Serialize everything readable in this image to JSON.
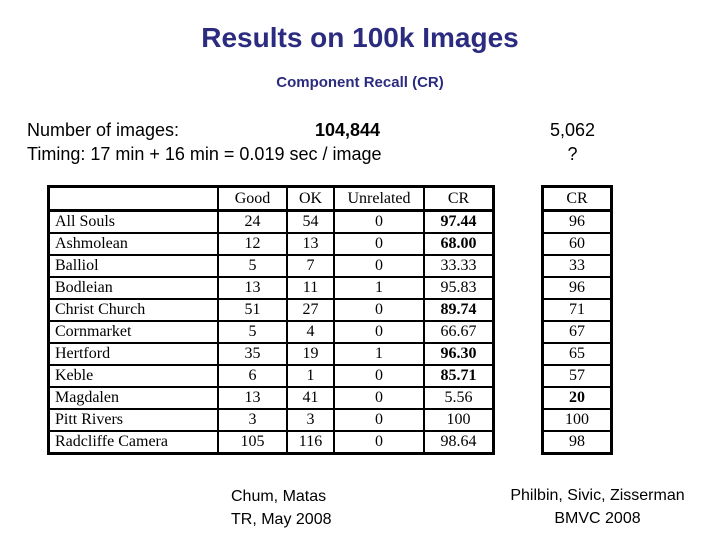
{
  "title": "Results on 100k Images",
  "subtitle": "Component Recall (CR)",
  "info": {
    "num_images_label": "Number of images:",
    "num_images_value": "104,844",
    "timing": "Timing: 17 min + 16 min = 0.019 sec / image",
    "right_count": "5,062",
    "right_timing": "?"
  },
  "main_table": {
    "headers": [
      "",
      "Good",
      "OK",
      "Unrelated",
      "CR"
    ],
    "rows": [
      {
        "name": "All Souls",
        "good": "24",
        "ok": "54",
        "unrelated": "0",
        "cr": "97.44",
        "cr_bold": true
      },
      {
        "name": "Ashmolean",
        "good": "12",
        "ok": "13",
        "unrelated": "0",
        "cr": "68.00",
        "cr_bold": true
      },
      {
        "name": "Balliol",
        "good": "5",
        "ok": "7",
        "unrelated": "0",
        "cr": "33.33",
        "cr_bold": false
      },
      {
        "name": "Bodleian",
        "good": "13",
        "ok": "11",
        "unrelated": "1",
        "cr": "95.83",
        "cr_bold": false
      },
      {
        "name": "Christ Church",
        "good": "51",
        "ok": "27",
        "unrelated": "0",
        "cr": "89.74",
        "cr_bold": true
      },
      {
        "name": "Cornmarket",
        "good": "5",
        "ok": "4",
        "unrelated": "0",
        "cr": "66.67",
        "cr_bold": false
      },
      {
        "name": "Hertford",
        "good": "35",
        "ok": "19",
        "unrelated": "1",
        "cr": "96.30",
        "cr_bold": true
      },
      {
        "name": "Keble",
        "good": "6",
        "ok": "1",
        "unrelated": "0",
        "cr": "85.71",
        "cr_bold": true
      },
      {
        "name": "Magdalen",
        "good": "13",
        "ok": "41",
        "unrelated": "0",
        "cr": "5.56",
        "cr_bold": false
      },
      {
        "name": "Pitt Rivers",
        "good": "3",
        "ok": "3",
        "unrelated": "0",
        "cr": "100",
        "cr_bold": false
      },
      {
        "name": "Radcliffe Camera",
        "good": "105",
        "ok": "116",
        "unrelated": "0",
        "cr": "98.64",
        "cr_bold": false
      }
    ]
  },
  "cr_table": {
    "header": "CR",
    "values": [
      {
        "value": "96",
        "bold": false
      },
      {
        "value": "60",
        "bold": false
      },
      {
        "value": "33",
        "bold": false
      },
      {
        "value": "96",
        "bold": false
      },
      {
        "value": "71",
        "bold": false
      },
      {
        "value": "67",
        "bold": false
      },
      {
        "value": "65",
        "bold": false
      },
      {
        "value": "57",
        "bold": false
      },
      {
        "value": "20",
        "bold": true
      },
      {
        "value": "100",
        "bold": false
      },
      {
        "value": "98",
        "bold": false
      }
    ]
  },
  "footnotes": {
    "left_line1": "Chum, Matas",
    "left_line2": "TR, May 2008",
    "right_line1": "Philbin, Sivic, Zisserman",
    "right_line2": "BMVC 2008"
  },
  "colors": {
    "title": "#2b2b7f",
    "text": "#000000",
    "background": "#ffffff"
  }
}
